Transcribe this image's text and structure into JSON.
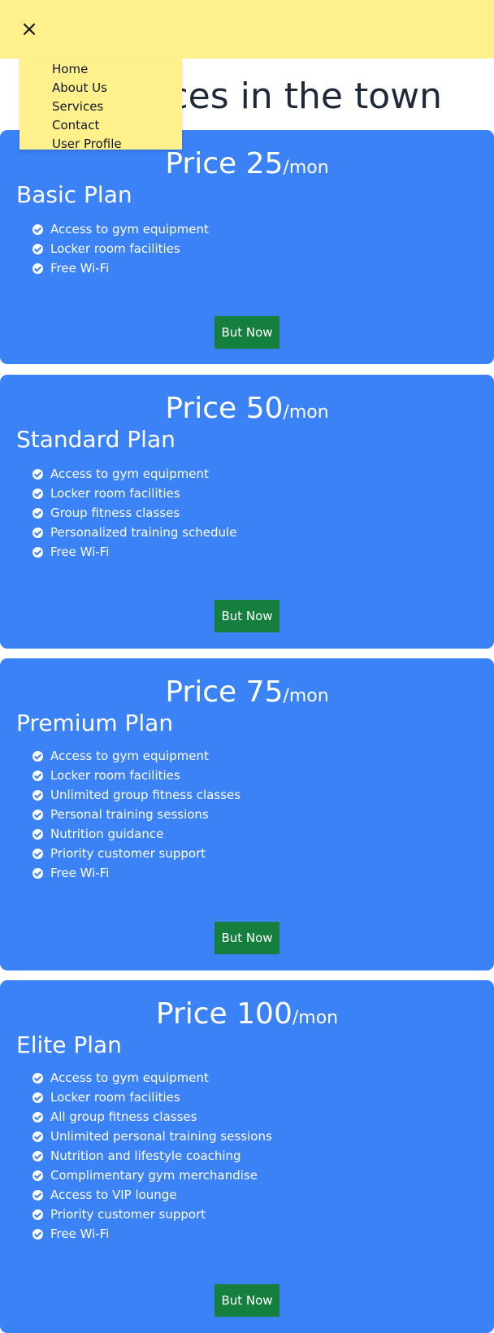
{
  "header": {
    "close_icon": "×",
    "menu": [
      "Home",
      "About Us",
      "Services",
      "Contact",
      "User Profile"
    ]
  },
  "headline": "ces in the town",
  "plans": [
    {
      "price": "Price 25",
      "unit": "/mon",
      "name": "Basic Plan",
      "features": [
        "Access to gym equipment",
        "Locker room facilities",
        "Free Wi-Fi"
      ],
      "button": "But Now"
    },
    {
      "price": "Price 50",
      "unit": "/mon",
      "name": "Standard Plan",
      "features": [
        "Access to gym equipment",
        "Locker room facilities",
        "Group fitness classes",
        "Personalized training schedule",
        "Free Wi-Fi"
      ],
      "button": "But Now"
    },
    {
      "price": "Price 75",
      "unit": "/mon",
      "name": "Premium Plan",
      "features": [
        "Access to gym equipment",
        "Locker room facilities",
        "Unlimited group fitness classes",
        "Personal training sessions",
        "Nutrition guidance",
        "Priority customer support",
        "Free Wi-Fi"
      ],
      "button": "But Now"
    },
    {
      "price": "Price 100",
      "unit": "/mon",
      "name": "Elite Plan",
      "features": [
        "Access to gym equipment",
        "Locker room facilities",
        "All group fitness classes",
        "Unlimited personal training sessions",
        "Nutrition and lifestyle coaching",
        "Complimentary gym merchandise",
        "Access to VIP lounge",
        "Priority customer support",
        "Free Wi-Fi"
      ],
      "button": "But Now"
    }
  ],
  "colors": {
    "header_bg": "#fef08a",
    "card_bg": "#3b82f6",
    "button_bg": "#15803d"
  }
}
